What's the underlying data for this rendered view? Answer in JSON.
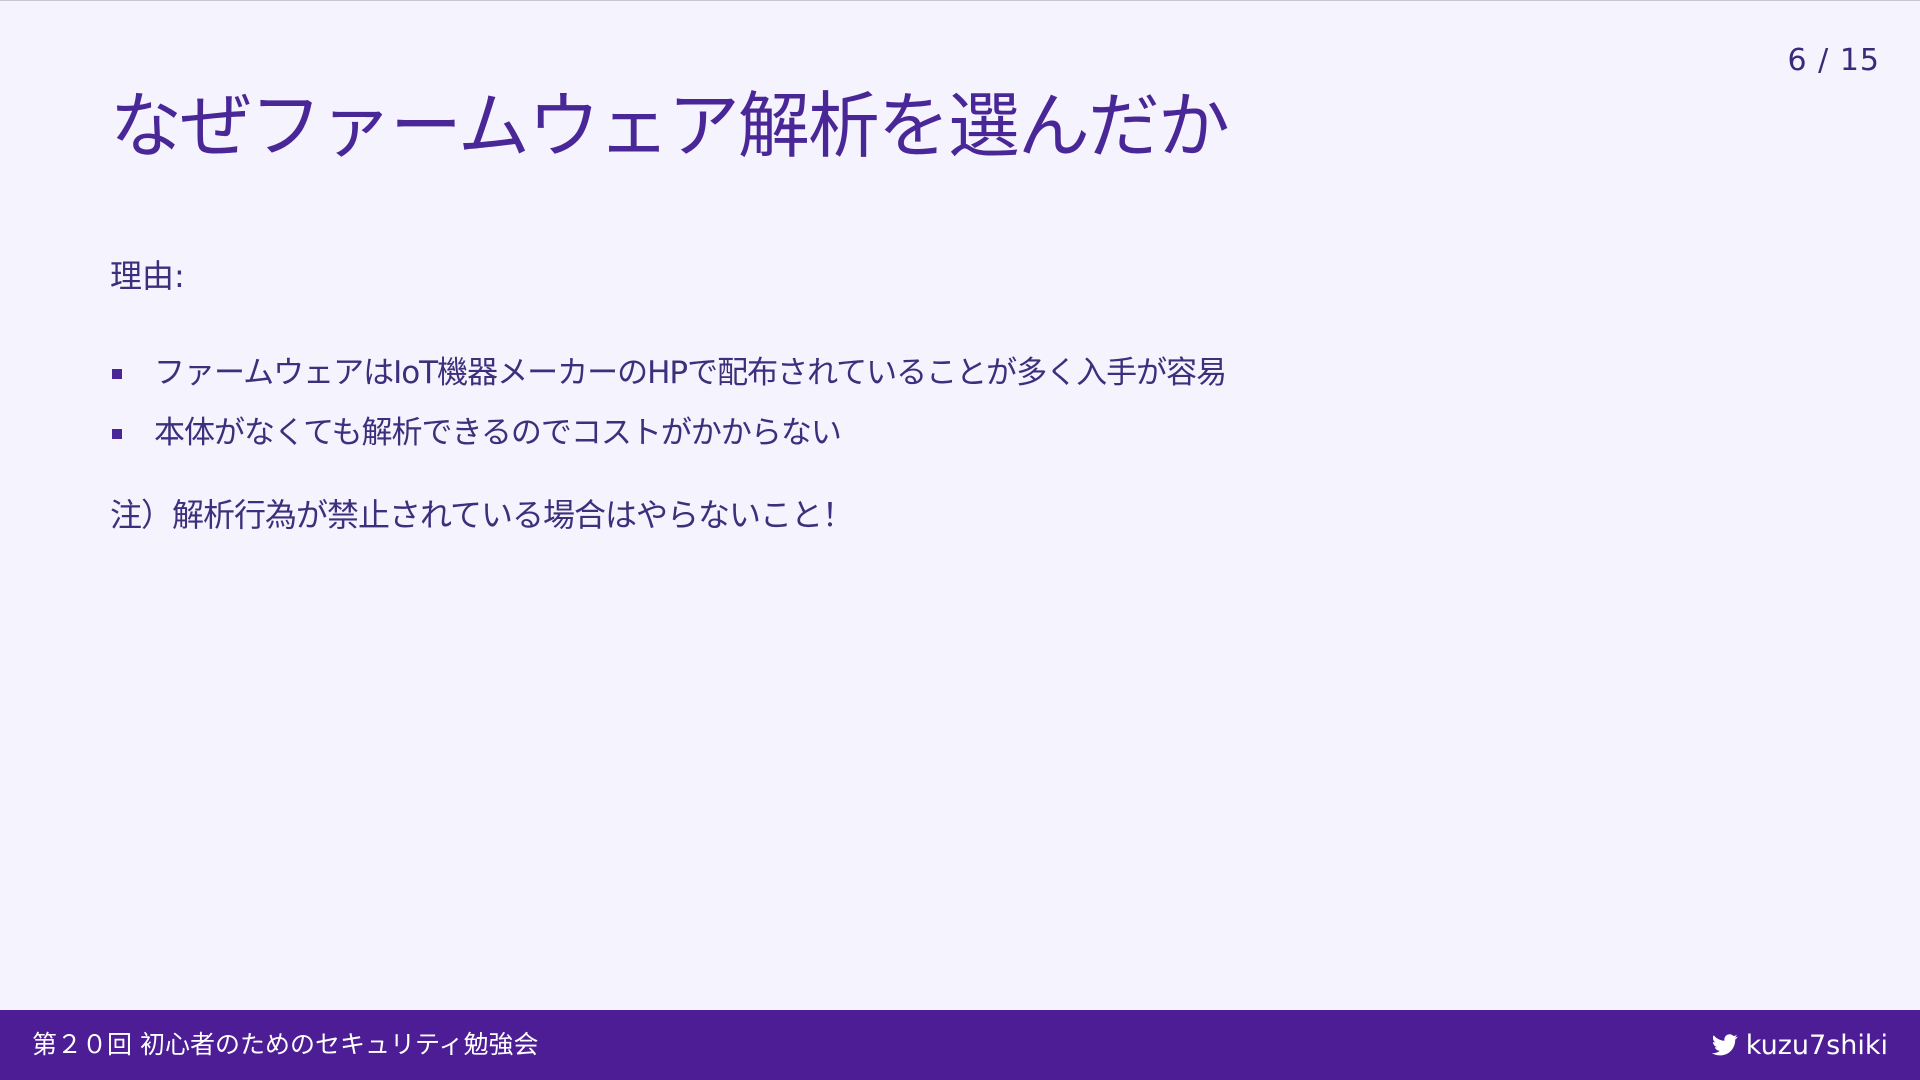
{
  "page": {
    "number": "6 / 15"
  },
  "slide": {
    "title": "なぜファームウェア解析を選んだか",
    "reason_label": "理由:",
    "bullets": [
      "ファームウェアはIoT機器メーカーのHPで配布されていることが多く入手が容易",
      "本体がなくても解析できるのでコストがかからない"
    ],
    "note": "注）解析行為が禁止されている場合はやらないこと！"
  },
  "footer": {
    "title": "第２０回 初心者のためのセキュリティ勉強会",
    "handle": "kuzu7shiki",
    "handle_icon": "twitter-icon"
  },
  "colors": {
    "background": "#f5f3fd",
    "title": "#4a2796",
    "body_text": "#3d2f7c",
    "footer_bar": "#4c1d95",
    "footer_text": "#ffffff"
  }
}
